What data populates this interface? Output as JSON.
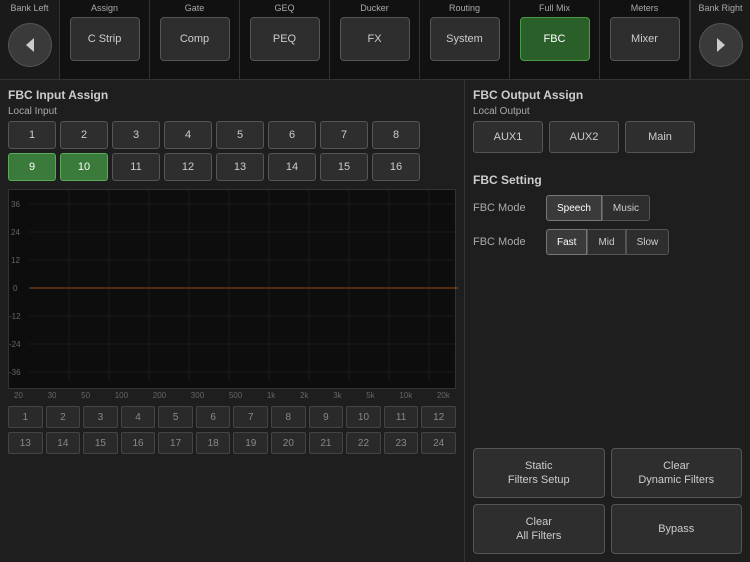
{
  "nav": {
    "bank_left_label": "Bank Left",
    "bank_right_label": "Bank Right",
    "tabs": [
      {
        "label": "Assign",
        "btn": "C Strip",
        "active": false
      },
      {
        "label": "Gate",
        "btn": "Comp",
        "active": false
      },
      {
        "label": "GEQ",
        "btn": "PEQ",
        "active": false
      },
      {
        "label": "Ducker",
        "btn": "FX",
        "active": false
      },
      {
        "label": "Routing",
        "btn": "System",
        "active": false
      },
      {
        "label": "Full Mix",
        "btn": "FBC",
        "active": true
      },
      {
        "label": "Meters",
        "btn": "Mixer",
        "active": false
      }
    ]
  },
  "left": {
    "section_title": "FBC Input Assign",
    "sub_title": "Local Input",
    "inputs_row1": [
      "1",
      "2",
      "3",
      "4",
      "5",
      "6",
      "7",
      "8"
    ],
    "inputs_row2": [
      "9",
      "10",
      "11",
      "12",
      "13",
      "14",
      "15",
      "16"
    ],
    "active_inputs": [
      "9",
      "10"
    ],
    "graph_y_labels": [
      "36",
      "24",
      "12",
      "0",
      "-12",
      "-24",
      "-36"
    ],
    "graph_x_labels": [
      "20",
      "30",
      "50",
      "100",
      "200",
      "300",
      "500",
      "1k",
      "2k",
      "3k",
      "5k",
      "10k",
      "20k"
    ],
    "filter_row1": [
      "1",
      "2",
      "3",
      "4",
      "5",
      "6",
      "7",
      "8",
      "9",
      "10",
      "11",
      "12"
    ],
    "filter_row2": [
      "13",
      "14",
      "15",
      "16",
      "17",
      "18",
      "19",
      "20",
      "21",
      "22",
      "23",
      "24"
    ]
  },
  "right": {
    "output_section_title": "FBC Output Assign",
    "output_sub_title": "Local Output",
    "output_buttons": [
      "AUX1",
      "AUX2",
      "Main"
    ],
    "fbc_setting_title": "FBC Setting",
    "fbc_mode_label": "FBC Mode",
    "fbc_mode_options": [
      "Speech",
      "Music"
    ],
    "fbc_mode2_label": "FBC Mode",
    "fbc_mode2_options": [
      "Fast",
      "Mid",
      "Slow"
    ],
    "action_buttons": [
      {
        "label": "Static\nFilters Setup",
        "id": "static-filters"
      },
      {
        "label": "Clear\nDynamic Filters",
        "id": "clear-dynamic"
      },
      {
        "label": "Clear\nAll Filters",
        "id": "clear-all"
      },
      {
        "label": "Bypass",
        "id": "bypass"
      }
    ]
  }
}
